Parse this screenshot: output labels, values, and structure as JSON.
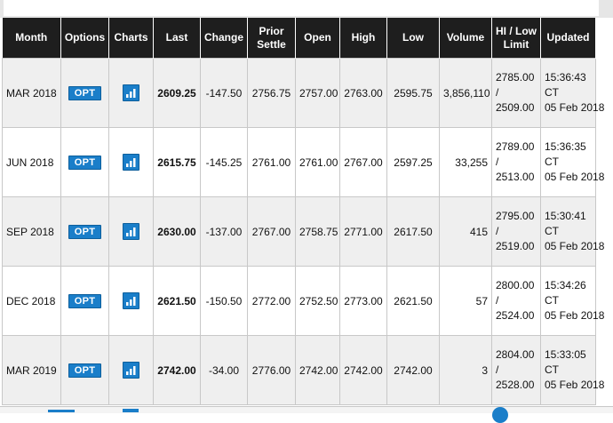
{
  "columns": [
    "Month",
    "Options",
    "Charts",
    "Last",
    "Change",
    "Prior Settle",
    "Open",
    "High",
    "Low",
    "Volume",
    "HI / Low Limit",
    "Updated"
  ],
  "rows": [
    {
      "month": "MAR 2018",
      "opt": "OPT",
      "last": "2609.25",
      "change": "-147.50",
      "prior": "2756.75",
      "open": "2757.00",
      "high": "2763.00",
      "low": "2595.75",
      "volume": "3,856,110",
      "limit_hi": "2785.00",
      "limit_sep": "/",
      "limit_low": "2509.00",
      "upd_time": "15:36:43",
      "upd_tz": "CT",
      "upd_date": "05 Feb 2018"
    },
    {
      "month": "JUN 2018",
      "opt": "OPT",
      "last": "2615.75",
      "change": "-145.25",
      "prior": "2761.00",
      "open": "2761.00",
      "high": "2767.00",
      "low": "2597.25",
      "volume": "33,255",
      "limit_hi": "2789.00",
      "limit_sep": "/",
      "limit_low": "2513.00",
      "upd_time": "15:36:35",
      "upd_tz": "CT",
      "upd_date": "05 Feb 2018"
    },
    {
      "month": "SEP 2018",
      "opt": "OPT",
      "last": "2630.00",
      "change": "-137.00",
      "prior": "2767.00",
      "open": "2758.75",
      "high": "2771.00",
      "low": "2617.50",
      "volume": "415",
      "limit_hi": "2795.00",
      "limit_sep": "/",
      "limit_low": "2519.00",
      "upd_time": "15:30:41",
      "upd_tz": "CT",
      "upd_date": "05 Feb 2018"
    },
    {
      "month": "DEC 2018",
      "opt": "OPT",
      "last": "2621.50",
      "change": "-150.50",
      "prior": "2772.00",
      "open": "2752.50",
      "high": "2773.00",
      "low": "2621.50",
      "volume": "57",
      "limit_hi": "2800.00",
      "limit_sep": "/",
      "limit_low": "2524.00",
      "upd_time": "15:34:26",
      "upd_tz": "CT",
      "upd_date": "05 Feb 2018"
    },
    {
      "month": "MAR 2019",
      "opt": "OPT",
      "last": "2742.00",
      "change": "-34.00",
      "prior": "2776.00",
      "open": "2742.00",
      "high": "2742.00",
      "low": "2742.00",
      "volume": "3",
      "limit_hi": "2804.00",
      "limit_sep": "/",
      "limit_low": "2528.00",
      "upd_time": "15:33:05",
      "upd_tz": "CT",
      "upd_date": "05 Feb 2018"
    }
  ],
  "icons": {
    "chart": "bar-chart-icon"
  },
  "colors": {
    "header_bg": "#1e1e1e",
    "negative": "#e0191f",
    "button": "#1a7ec9",
    "row_alt": "#efefef"
  }
}
